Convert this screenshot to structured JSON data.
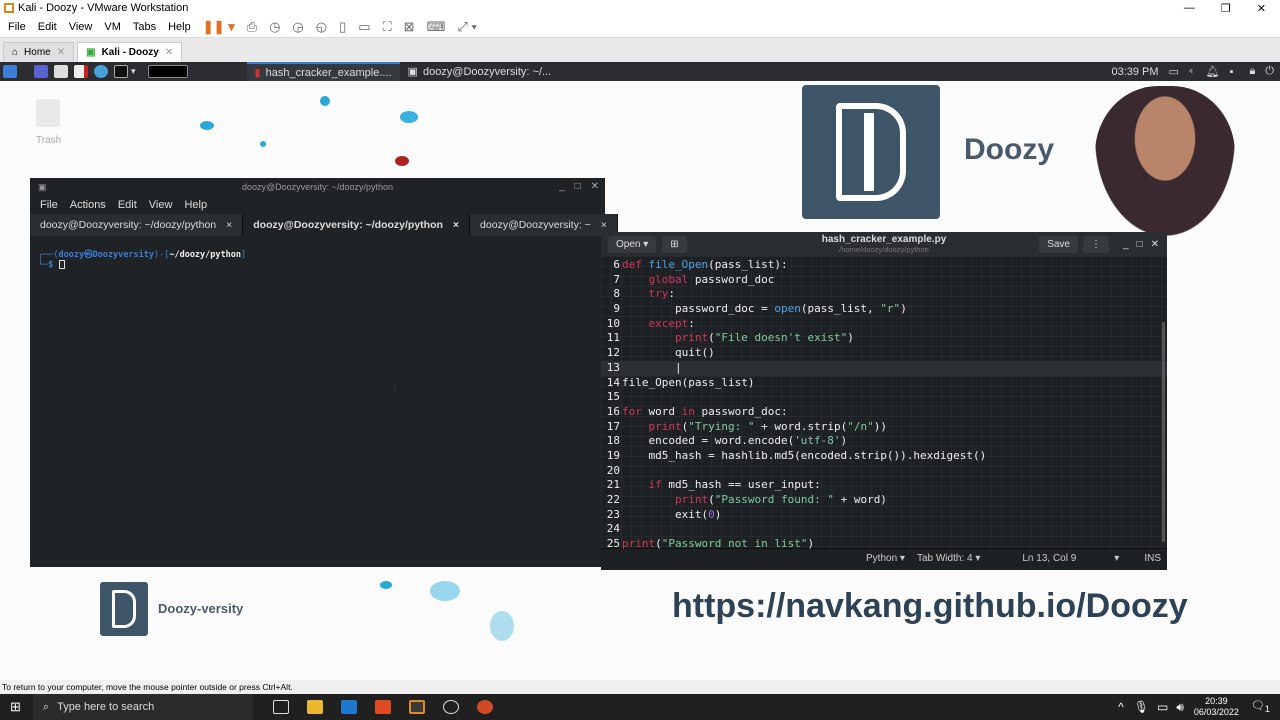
{
  "vmware": {
    "title": "Kali - Doozy - VMware Workstation",
    "menu": [
      "File",
      "Edit",
      "View",
      "VM",
      "Tabs",
      "Help"
    ],
    "tabs": [
      {
        "label": "Home",
        "active": false
      },
      {
        "label": "Kali - Doozy",
        "active": true
      }
    ],
    "status_text": "To return to your computer, move the mouse pointer outside or press Ctrl+Alt."
  },
  "kali_panel": {
    "tasks": [
      "hash_cracker_example....",
      "doozy@Doozyversity: ~/..."
    ],
    "clock": "03:39 PM"
  },
  "desktop": {
    "trash_label": "Trash",
    "brand_top": "Doozy",
    "brand_bottom": "Doozy-versity",
    "url": "https://navkang.github.io/Doozy"
  },
  "terminal": {
    "title": "doozy@Doozyversity: ~/doozy/python",
    "menu": [
      "File",
      "Actions",
      "Edit",
      "View",
      "Help"
    ],
    "tabs": [
      {
        "label": "doozy@Doozyversity: ~/doozy/python",
        "active": false
      },
      {
        "label": "doozy@Doozyversity: ~/doozy/python",
        "active": true
      },
      {
        "label": "doozy@Doozyversity: ~",
        "active": false
      }
    ],
    "prompt_user": "doozy㉿Doozyversity",
    "prompt_path": "~/doozy/python",
    "prompt_symbol": "$"
  },
  "editor": {
    "open_label": "Open",
    "filename": "hash_cracker_example.py",
    "path": "/home/doozy/doozy/python",
    "save_label": "Save",
    "language": "Python",
    "tab_width": "Tab Width: 4",
    "position": "Ln 13, Col 9",
    "mode": "INS",
    "current_line": 13,
    "lines": [
      {
        "n": "6",
        "t": [
          [
            "kw",
            "def "
          ],
          [
            "fn",
            "file_Open"
          ],
          [
            "tx",
            "(pass_list):"
          ]
        ]
      },
      {
        "n": "7",
        "t": [
          [
            "tx",
            "    "
          ],
          [
            "kw",
            "global "
          ],
          [
            "tx",
            "password_doc"
          ]
        ]
      },
      {
        "n": "8",
        "t": [
          [
            "tx",
            "    "
          ],
          [
            "kw",
            "try"
          ],
          [
            "tx",
            ":"
          ]
        ]
      },
      {
        "n": "9",
        "t": [
          [
            "tx",
            "        password_doc = "
          ],
          [
            "fn",
            "open"
          ],
          [
            "tx",
            "(pass_list, "
          ],
          [
            "st",
            "\"r\""
          ],
          [
            "tx",
            ")"
          ]
        ]
      },
      {
        "n": "10",
        "t": [
          [
            "tx",
            "    "
          ],
          [
            "kw",
            "except"
          ],
          [
            "tx",
            ":"
          ]
        ]
      },
      {
        "n": "11",
        "t": [
          [
            "tx",
            "        "
          ],
          [
            "kw",
            "print"
          ],
          [
            "tx",
            "("
          ],
          [
            "st",
            "\"File doesn't exist\""
          ],
          [
            "tx",
            ")"
          ]
        ]
      },
      {
        "n": "12",
        "t": [
          [
            "tx",
            "        quit()"
          ]
        ]
      },
      {
        "n": "13",
        "t": [
          [
            "tx",
            "        |"
          ]
        ]
      },
      {
        "n": "14",
        "t": [
          [
            "tx",
            "file_Open(pass_list)"
          ]
        ]
      },
      {
        "n": "15",
        "t": []
      },
      {
        "n": "16",
        "t": [
          [
            "kw",
            "for "
          ],
          [
            "tx",
            "word "
          ],
          [
            "kw",
            "in "
          ],
          [
            "tx",
            "password_doc:"
          ]
        ]
      },
      {
        "n": "17",
        "t": [
          [
            "tx",
            "    "
          ],
          [
            "kw",
            "print"
          ],
          [
            "tx",
            "("
          ],
          [
            "st",
            "\"Trying: \""
          ],
          [
            "tx",
            " + word.strip("
          ],
          [
            "st",
            "\"/n\""
          ],
          [
            "tx",
            "))"
          ]
        ]
      },
      {
        "n": "18",
        "t": [
          [
            "tx",
            "    encoded = word.encode("
          ],
          [
            "st",
            "'utf-8'"
          ],
          [
            "tx",
            ")"
          ]
        ]
      },
      {
        "n": "19",
        "t": [
          [
            "tx",
            "    md5_hash = hashlib.md5(encoded.strip()).hexdigest()"
          ]
        ]
      },
      {
        "n": "20",
        "t": []
      },
      {
        "n": "21",
        "t": [
          [
            "tx",
            "    "
          ],
          [
            "kw",
            "if "
          ],
          [
            "tx",
            "md5_hash == user_input:"
          ]
        ]
      },
      {
        "n": "22",
        "t": [
          [
            "tx",
            "        "
          ],
          [
            "kw",
            "print"
          ],
          [
            "tx",
            "("
          ],
          [
            "st",
            "\"Password found: \""
          ],
          [
            "tx",
            " + word)"
          ]
        ]
      },
      {
        "n": "23",
        "t": [
          [
            "tx",
            "        exit("
          ],
          [
            "nm",
            "0"
          ],
          [
            "tx",
            ")"
          ]
        ]
      },
      {
        "n": "24",
        "t": []
      },
      {
        "n": "25",
        "t": [
          [
            "kw",
            "print"
          ],
          [
            "tx",
            "("
          ],
          [
            "st",
            "\"Password not in list\""
          ],
          [
            "tx",
            ")"
          ]
        ]
      }
    ]
  },
  "windows_taskbar": {
    "search_placeholder": "Type here to search",
    "time": "20:39",
    "date": "06/03/2022",
    "notifications": "1"
  },
  "colors": {
    "kali_blue": "#3c7ed8",
    "keyword": "#d2345a",
    "string": "#7fc9a0",
    "builtin": "#4ea4e8"
  }
}
